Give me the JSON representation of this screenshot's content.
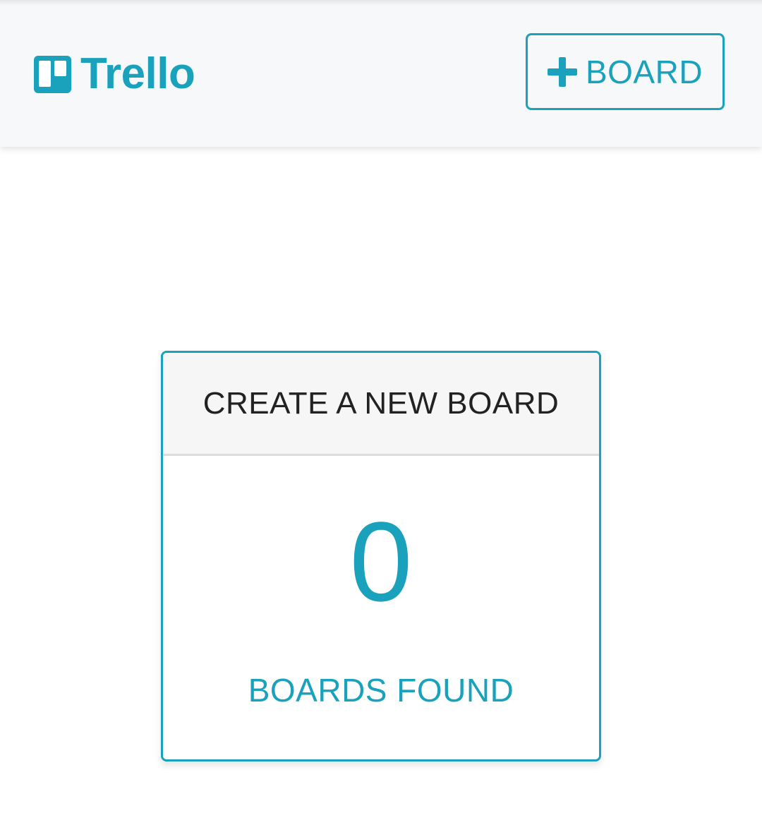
{
  "header": {
    "app_name": "Trello",
    "add_board_label": "BOARD",
    "logo_icon": "trello-logo-icon",
    "add_icon": "plus-icon"
  },
  "card": {
    "create_label": "CREATE A NEW BOARD",
    "count": "0",
    "count_label": "BOARDS FOUND"
  },
  "colors": {
    "accent": "#1aa1bb",
    "header_bg": "#f7f8f9",
    "card_header_bg": "#f6f6f6",
    "text_dark": "#222222"
  }
}
